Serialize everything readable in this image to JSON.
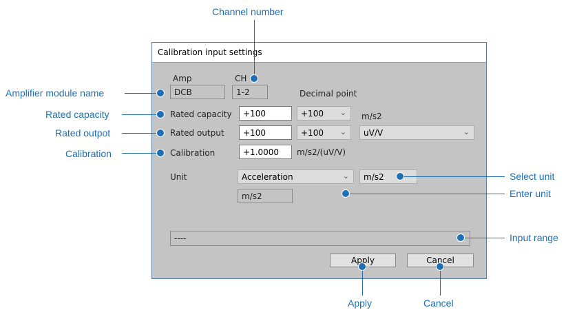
{
  "dialog": {
    "title": "Calibration input settings",
    "amp_label": "Amp",
    "ch_label": "CH",
    "amp_value": "DCB",
    "ch_value": "1-2",
    "decimal_point_label": "Decimal point",
    "rated_capacity": {
      "label": "Rated capacity",
      "value": "+100",
      "select": "+100",
      "unit": "m/s2"
    },
    "rated_output": {
      "label": "Rated output",
      "value": "+100",
      "select": "+100",
      "unit_select": "uV/V"
    },
    "calibration": {
      "label": "Calibration",
      "value": "+1.0000",
      "unit": "m/s2/(uV/V)"
    },
    "unit": {
      "label": "Unit",
      "select": "Acceleration",
      "unit_select": "m/s2",
      "entered": "m/s2"
    },
    "input_range": "----",
    "apply_label": "Apply",
    "cancel_label": "Cancel"
  },
  "annotations": {
    "channel_number": "Channel number",
    "amplifier_module_name": "Amplifier module name",
    "rated_capacity": "Rated capacity",
    "rated_outpot": "Rated outpot",
    "calibration": "Calibration",
    "select_unit": "Select unit",
    "enter_unit": "Enter unit",
    "input_range": "Input range",
    "apply": "Apply",
    "cancel": "Cancel"
  },
  "colors": {
    "annotation": "#1a6fc0",
    "dialog_bg": "#c4c4c4"
  }
}
